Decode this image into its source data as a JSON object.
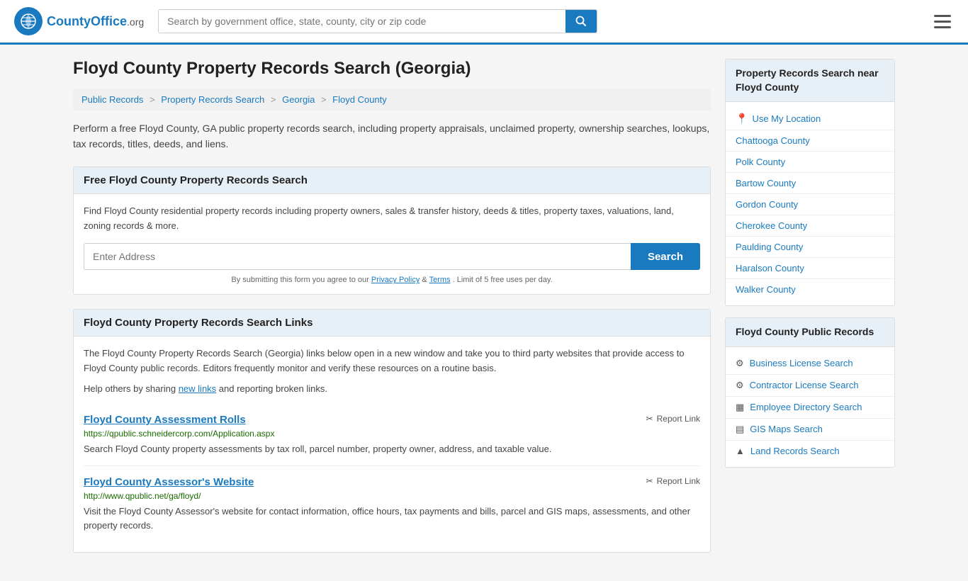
{
  "header": {
    "logo_text": "CountyOffice",
    "logo_org": ".org",
    "search_placeholder": "Search by government office, state, county, city or zip code",
    "menu_icon": "menu"
  },
  "page": {
    "title": "Floyd County Property Records Search (Georgia)",
    "breadcrumb": [
      {
        "label": "Public Records",
        "href": "#"
      },
      {
        "label": "Property Records Search",
        "href": "#"
      },
      {
        "label": "Georgia",
        "href": "#"
      },
      {
        "label": "Floyd County",
        "href": "#"
      }
    ],
    "intro_text": "Perform a free Floyd County, GA public property records search, including property appraisals, unclaimed property, ownership searches, lookups, tax records, titles, deeds, and liens."
  },
  "free_search": {
    "header": "Free Floyd County Property Records Search",
    "desc": "Find Floyd County residential property records including property owners, sales & transfer history, deeds & titles, property taxes, valuations, land, zoning records & more.",
    "input_placeholder": "Enter Address",
    "search_btn": "Search",
    "disclaimer": "By submitting this form you agree to our",
    "privacy_link": "Privacy Policy",
    "terms_link": "Terms",
    "limit_text": ". Limit of 5 free uses per day."
  },
  "links_section": {
    "header": "Floyd County Property Records Search Links",
    "desc": "The Floyd County Property Records Search (Georgia) links below open in a new window and take you to third party websites that provide access to Floyd County public records. Editors frequently monitor and verify these resources on a routine basis.",
    "share_text": "Help others by sharing",
    "new_links_label": "new links",
    "report_text": "and reporting broken links.",
    "links": [
      {
        "title": "Floyd County Assessment Rolls",
        "url": "https://qpublic.schneidercorp.com/Application.aspx",
        "desc": "Search Floyd County property assessments by tax roll, parcel number, property owner, address, and taxable value.",
        "report_label": "Report Link"
      },
      {
        "title": "Floyd County Assessor's Website",
        "url": "http://www.qpublic.net/ga/floyd/",
        "desc": "Visit the Floyd County Assessor's website for contact information, office hours, tax payments and bills, parcel and GIS maps, assessments, and other property records.",
        "report_label": "Report Link"
      }
    ]
  },
  "sidebar": {
    "nearby_header": "Property Records Search\nnear Floyd County",
    "use_my_location": "Use My Location",
    "nearby_counties": [
      "Chattooga County",
      "Polk County",
      "Bartow County",
      "Gordon County",
      "Cherokee County",
      "Paulding County",
      "Haralson County",
      "Walker County"
    ],
    "public_records_header": "Floyd County Public Records",
    "public_records_links": [
      {
        "icon": "⚙",
        "label": "Business License Search"
      },
      {
        "icon": "⚙",
        "label": "Contractor License Search"
      },
      {
        "icon": "▦",
        "label": "Employee Directory Search"
      },
      {
        "icon": "▤",
        "label": "GIS Maps Search"
      },
      {
        "icon": "▲",
        "label": "Land Records Search"
      }
    ]
  }
}
